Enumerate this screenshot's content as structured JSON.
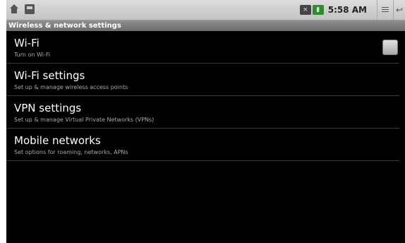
{
  "status_bar": {
    "time": "5:58 AM",
    "left_icons": [
      "home-icon",
      "sd-card-icon"
    ],
    "right_icons": [
      "mute-icon",
      "battery-icon",
      "menu-icon",
      "back-icon"
    ]
  },
  "header": {
    "title": "Wireless & network settings"
  },
  "items": [
    {
      "title": "Wi-Fi",
      "summary": "Turn on Wi-Fi",
      "checkbox": false
    },
    {
      "title": "Wi-Fi settings",
      "summary": "Set up & manage wireless access points"
    },
    {
      "title": "VPN settings",
      "summary": "Set up & manage Virtual Private Networks (VPNs)"
    },
    {
      "title": "Mobile networks",
      "summary": "Set options for roaming, networks, APNs"
    }
  ],
  "colors": {
    "background": "#000000",
    "header": "#7a7a7a",
    "title": "#ffffff",
    "summary": "#a8a8a8"
  }
}
